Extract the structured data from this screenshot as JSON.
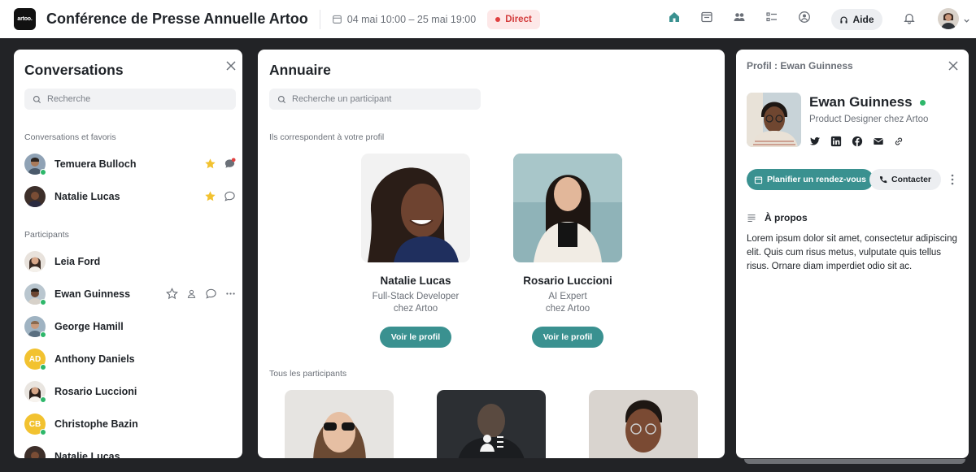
{
  "header": {
    "logo_text": "artoo.",
    "event_title": "Conférence de Presse Annuelle Artoo",
    "dates": "04 mai 10:00  –  25 mai 19:00",
    "live_label": "Direct",
    "help_label": "Aide",
    "icons": [
      "home-icon",
      "calendar-icon",
      "people-icon",
      "list-icon",
      "profile-icon",
      "bell-icon"
    ]
  },
  "conversations": {
    "title": "Conversations",
    "search_placeholder": "Recherche",
    "favorites_label": "Conversations et favoris",
    "favorites": [
      {
        "name": "Temuera Bulloch",
        "online": true
      },
      {
        "name": "Natalie Lucas",
        "online": false
      }
    ],
    "participants_label": "Participants",
    "participants": [
      {
        "name": "Leia Ford",
        "initials": ""
      },
      {
        "name": "Ewan Guinness",
        "initials": ""
      },
      {
        "name": "George Hamill",
        "initials": ""
      },
      {
        "name": "Anthony Daniels",
        "initials": "AD"
      },
      {
        "name": "Rosario Luccioni",
        "initials": ""
      },
      {
        "name": "Christophe Bazin",
        "initials": "CB"
      },
      {
        "name": "Natalie Lucas",
        "initials": ""
      }
    ]
  },
  "directory": {
    "title": "Annuaire",
    "search_placeholder": "Recherche un participant",
    "matching_label": "Ils correspondent à votre profil",
    "matches": [
      {
        "name": "Natalie Lucas",
        "role_line1": "Full-Stack Developer",
        "role_line2": "chez Artoo",
        "button": "Voir le profil"
      },
      {
        "name": "Rosario Luccioni",
        "role_line1": "AI Expert",
        "role_line2": "chez Artoo",
        "button": "Voir le profil"
      }
    ],
    "all_label": "Tous les participants"
  },
  "profile": {
    "header": "Profil : Ewan Guinness",
    "name": "Ewan Guinness",
    "role": "Product Designer chez Artoo",
    "socials": [
      "twitter-icon",
      "linkedin-icon",
      "facebook-icon",
      "mail-icon",
      "link-icon"
    ],
    "plan_button": "Planifier un rendez-vous",
    "contact_button": "Contacter",
    "about_title": "À propos",
    "about_text": "Lorem ipsum dolor sit amet, consectetur adipiscing elit. Quis cum risus metus, vulputate quis tellus risus. Ornare diam imperdiet odio sit ac."
  },
  "colors": {
    "accent": "#3a9190",
    "online": "#2eb76a",
    "live": "#e04040",
    "star": "#f2c230"
  }
}
